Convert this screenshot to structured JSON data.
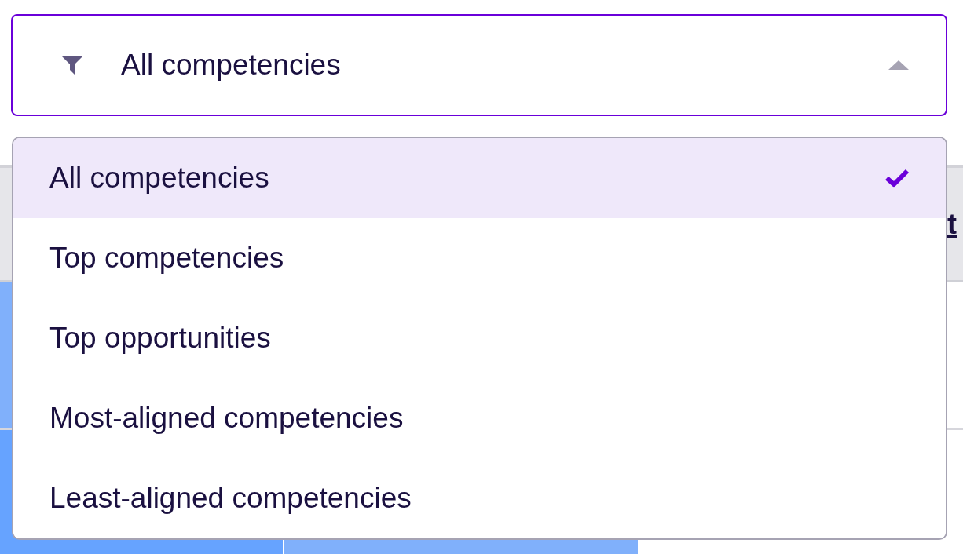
{
  "filter": {
    "value": "All competencies",
    "expanded": true
  },
  "menu": {
    "options": [
      {
        "label": "All competencies",
        "selected": true
      },
      {
        "label": "Top competencies",
        "selected": false
      },
      {
        "label": "Top opportunities",
        "selected": false
      },
      {
        "label": "Most-aligned competencies",
        "selected": false
      },
      {
        "label": "Least-aligned competencies",
        "selected": false
      }
    ]
  },
  "table": {
    "header": {
      "column_text": "t"
    }
  }
}
